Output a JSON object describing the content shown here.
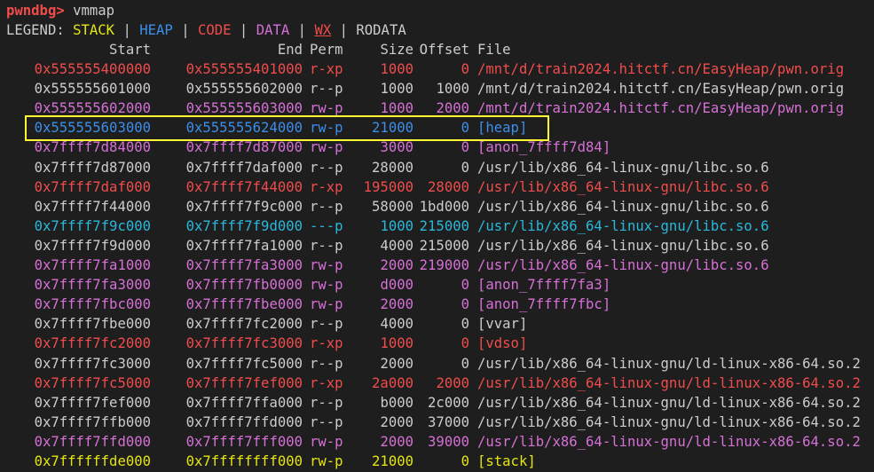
{
  "prompt": {
    "name": "pwndbg>",
    "command": " vmmap"
  },
  "legend": {
    "label": "LEGEND:",
    "items": [
      {
        "key": "stack",
        "text": "STACK"
      },
      {
        "key": "heap",
        "text": "HEAP"
      },
      {
        "key": "code",
        "text": "CODE"
      },
      {
        "key": "data",
        "text": "DATA"
      },
      {
        "key": "wx",
        "text": "WX"
      },
      {
        "key": "rodata",
        "text": "RODATA"
      }
    ],
    "separator": "|"
  },
  "colors": {
    "stack": "#e5e510",
    "heap": "#3b8eea",
    "code": "#f14c4c",
    "data": "#d670d6",
    "rodata": "#cccccc",
    "guard": "#29b8db",
    "highlight": "#ffff33",
    "background": "#1e1e1e"
  },
  "columns": {
    "start": "Start",
    "end": "End",
    "perm": "Perm",
    "size": "Size",
    "offset": "Offset",
    "file": "File"
  },
  "rows": [
    {
      "start": "0x555555400000",
      "end": "0x555555401000",
      "perm": "r-xp",
      "size": "1000",
      "offset": "0",
      "file": "/mnt/d/train2024.hitctf.cn/EasyHeap/pwn.orig",
      "kind": "code"
    },
    {
      "start": "0x555555601000",
      "end": "0x555555602000",
      "perm": "r--p",
      "size": "1000",
      "offset": "1000",
      "file": "/mnt/d/train2024.hitctf.cn/EasyHeap/pwn.orig",
      "kind": "rodata"
    },
    {
      "start": "0x555555602000",
      "end": "0x555555603000",
      "perm": "rw-p",
      "size": "1000",
      "offset": "2000",
      "file": "/mnt/d/train2024.hitctf.cn/EasyHeap/pwn.orig",
      "kind": "data"
    },
    {
      "start": "0x555555603000",
      "end": "0x555555624000",
      "perm": "rw-p",
      "size": "21000",
      "offset": "0",
      "file": "[heap]",
      "kind": "heap",
      "highlighted": true
    },
    {
      "start": "0x7ffff7d84000",
      "end": "0x7ffff7d87000",
      "perm": "rw-p",
      "size": "3000",
      "offset": "0",
      "file": "[anon_7ffff7d84]",
      "kind": "data"
    },
    {
      "start": "0x7ffff7d87000",
      "end": "0x7ffff7daf000",
      "perm": "r--p",
      "size": "28000",
      "offset": "0",
      "file": "/usr/lib/x86_64-linux-gnu/libc.so.6",
      "kind": "rodata"
    },
    {
      "start": "0x7ffff7daf000",
      "end": "0x7ffff7f44000",
      "perm": "r-xp",
      "size": "195000",
      "offset": "28000",
      "file": "/usr/lib/x86_64-linux-gnu/libc.so.6",
      "kind": "code"
    },
    {
      "start": "0x7ffff7f44000",
      "end": "0x7ffff7f9c000",
      "perm": "r--p",
      "size": "58000",
      "offset": "1bd000",
      "file": "/usr/lib/x86_64-linux-gnu/libc.so.6",
      "kind": "rodata"
    },
    {
      "start": "0x7ffff7f9c000",
      "end": "0x7ffff7f9d000",
      "perm": "---p",
      "size": "1000",
      "offset": "215000",
      "file": "/usr/lib/x86_64-linux-gnu/libc.so.6",
      "kind": "guard"
    },
    {
      "start": "0x7ffff7f9d000",
      "end": "0x7ffff7fa1000",
      "perm": "r--p",
      "size": "4000",
      "offset": "215000",
      "file": "/usr/lib/x86_64-linux-gnu/libc.so.6",
      "kind": "rodata"
    },
    {
      "start": "0x7ffff7fa1000",
      "end": "0x7ffff7fa3000",
      "perm": "rw-p",
      "size": "2000",
      "offset": "219000",
      "file": "/usr/lib/x86_64-linux-gnu/libc.so.6",
      "kind": "data"
    },
    {
      "start": "0x7ffff7fa3000",
      "end": "0x7ffff7fb0000",
      "perm": "rw-p",
      "size": "d000",
      "offset": "0",
      "file": "[anon_7ffff7fa3]",
      "kind": "data"
    },
    {
      "start": "0x7ffff7fbc000",
      "end": "0x7ffff7fbe000",
      "perm": "rw-p",
      "size": "2000",
      "offset": "0",
      "file": "[anon_7ffff7fbc]",
      "kind": "data"
    },
    {
      "start": "0x7ffff7fbe000",
      "end": "0x7ffff7fc2000",
      "perm": "r--p",
      "size": "4000",
      "offset": "0",
      "file": "[vvar]",
      "kind": "rodata"
    },
    {
      "start": "0x7ffff7fc2000",
      "end": "0x7ffff7fc3000",
      "perm": "r-xp",
      "size": "1000",
      "offset": "0",
      "file": "[vdso]",
      "kind": "code"
    },
    {
      "start": "0x7ffff7fc3000",
      "end": "0x7ffff7fc5000",
      "perm": "r--p",
      "size": "2000",
      "offset": "0",
      "file": "/usr/lib/x86_64-linux-gnu/ld-linux-x86-64.so.2",
      "kind": "rodata"
    },
    {
      "start": "0x7ffff7fc5000",
      "end": "0x7ffff7fef000",
      "perm": "r-xp",
      "size": "2a000",
      "offset": "2000",
      "file": "/usr/lib/x86_64-linux-gnu/ld-linux-x86-64.so.2",
      "kind": "code"
    },
    {
      "start": "0x7ffff7fef000",
      "end": "0x7ffff7ffa000",
      "perm": "r--p",
      "size": "b000",
      "offset": "2c000",
      "file": "/usr/lib/x86_64-linux-gnu/ld-linux-x86-64.so.2",
      "kind": "rodata"
    },
    {
      "start": "0x7ffff7ffb000",
      "end": "0x7ffff7ffd000",
      "perm": "r--p",
      "size": "2000",
      "offset": "37000",
      "file": "/usr/lib/x86_64-linux-gnu/ld-linux-x86-64.so.2",
      "kind": "rodata"
    },
    {
      "start": "0x7ffff7ffd000",
      "end": "0x7ffff7fff000",
      "perm": "rw-p",
      "size": "2000",
      "offset": "39000",
      "file": "/usr/lib/x86_64-linux-gnu/ld-linux-x86-64.so.2",
      "kind": "data"
    },
    {
      "start": "0x7ffffffde000",
      "end": "0x7ffffffff000",
      "perm": "rw-p",
      "size": "21000",
      "offset": "0",
      "file": "[stack]",
      "kind": "stack"
    }
  ]
}
